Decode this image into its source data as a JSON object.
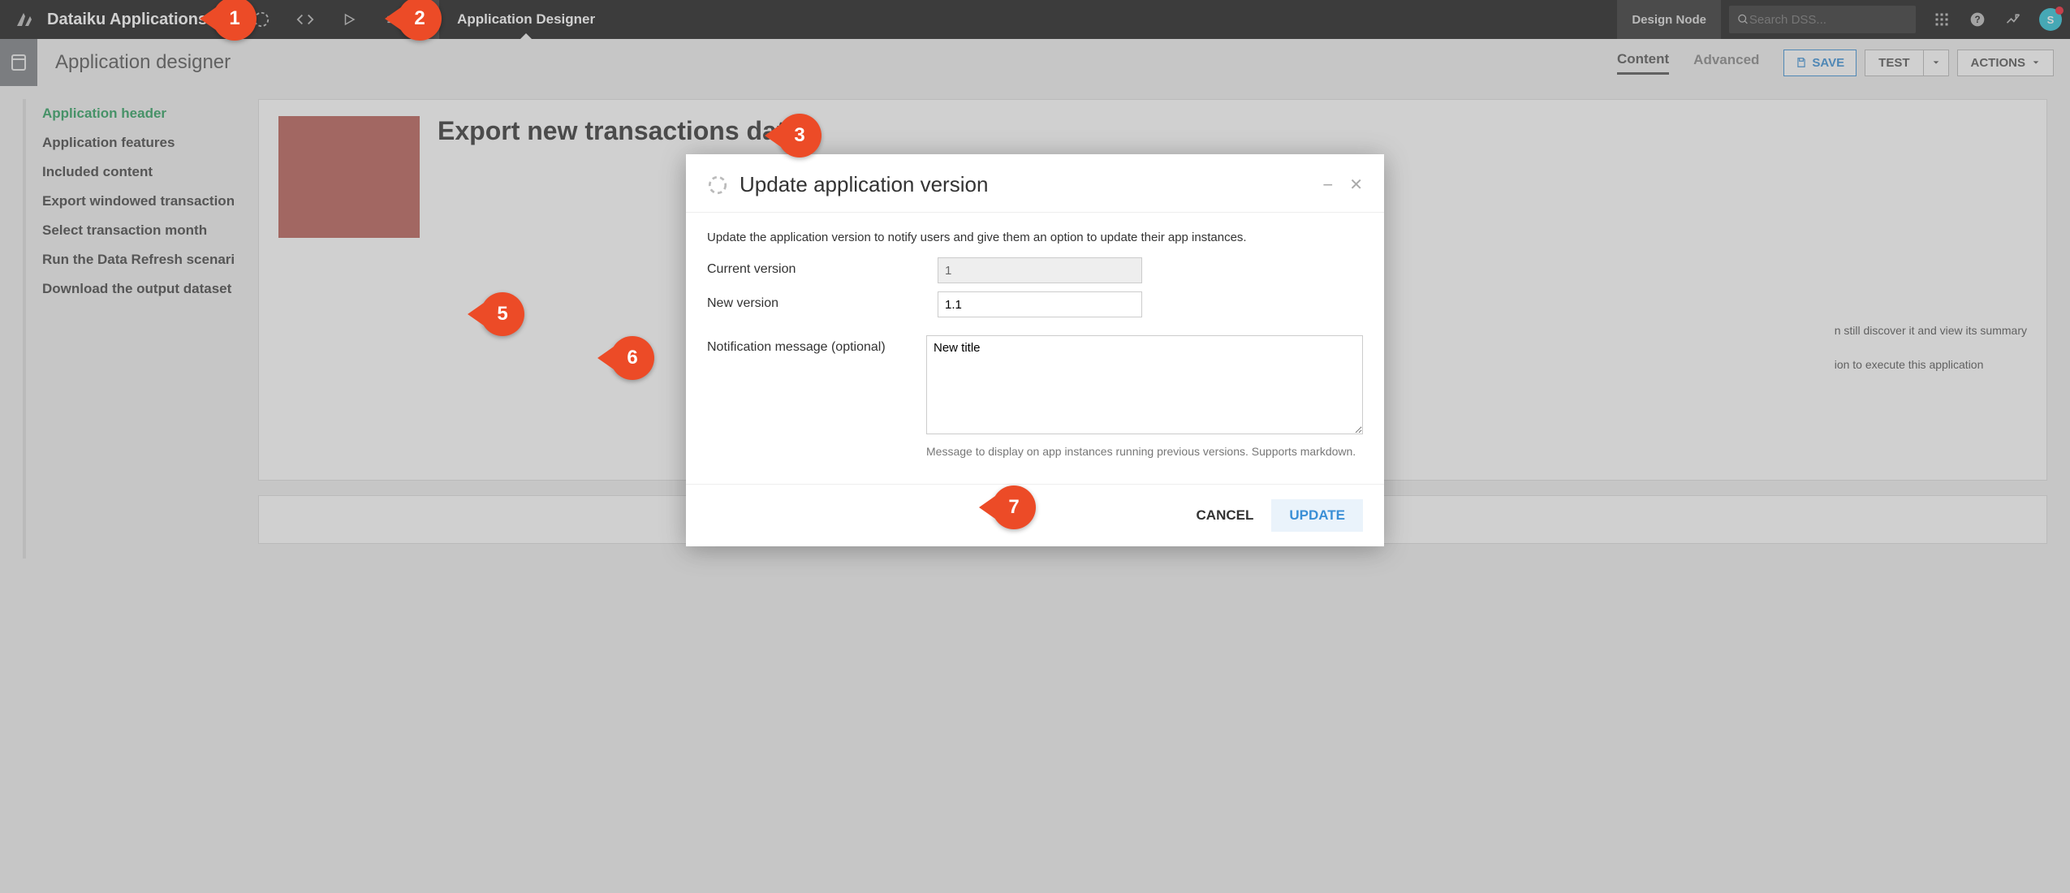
{
  "topbar": {
    "app_title": "Dataiku Applications",
    "active_tab": "Application Designer",
    "design_node": "Design Node",
    "search_placeholder": "Search DSS...",
    "avatar_letter": "S"
  },
  "subheader": {
    "title": "Application designer",
    "tabs": {
      "content": "Content",
      "advanced": "Advanced"
    },
    "buttons": {
      "save": "SAVE",
      "test": "TEST",
      "actions": "ACTIONS"
    }
  },
  "leftnav": [
    "Application header",
    "Application features",
    "Included content",
    "Export windowed transaction",
    "Select transaction month",
    "Run the Data Refresh scenario",
    "Download the output dataset"
  ],
  "content": {
    "heading": "Export new transactions data",
    "hint1": "n still discover it and view its summary",
    "hint2": "ion to execute this application"
  },
  "modal": {
    "title": "Update application version",
    "instruction": "Update the application version to notify users and give them an option to update their app instances.",
    "labels": {
      "current": "Current version",
      "new": "New version",
      "message": "Notification message (optional)"
    },
    "values": {
      "current": "1",
      "new": "1.1",
      "message": "New title"
    },
    "hint": "Message to display on app instances running previous versions. Supports markdown.",
    "buttons": {
      "cancel": "CANCEL",
      "update": "UPDATE"
    }
  },
  "callouts": {
    "1": "1",
    "2": "2",
    "3": "3",
    "5": "5",
    "6": "6",
    "7": "7"
  }
}
